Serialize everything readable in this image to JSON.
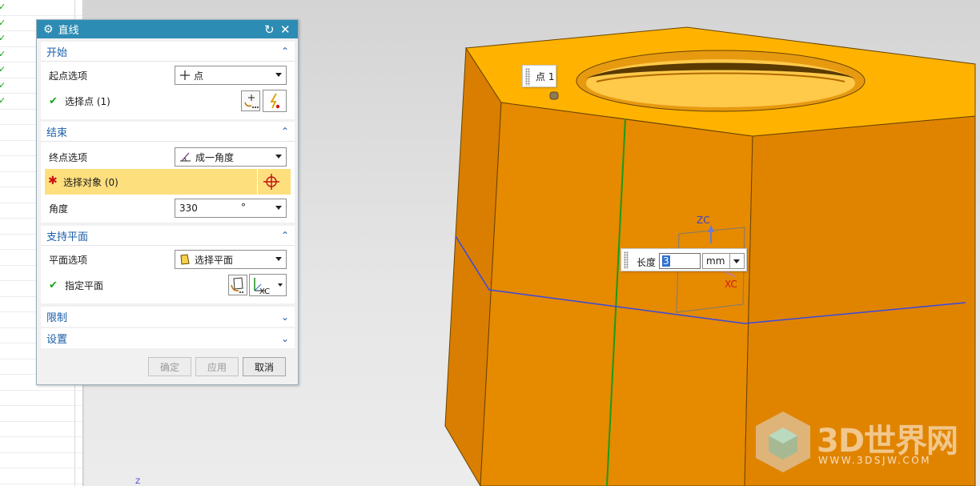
{
  "dialog": {
    "title": "直线",
    "sections": {
      "start": {
        "title": "开始",
        "option_label": "起点选项",
        "option_value": "点",
        "select_label": "选择点 (1)"
      },
      "end": {
        "title": "结束",
        "option_label": "终点选项",
        "option_value": "成一角度",
        "select_label": "选择对象 (0)",
        "angle_label": "角度",
        "angle_value": "330",
        "angle_unit": "°"
      },
      "support_plane": {
        "title": "支持平面",
        "option_label": "平面选项",
        "option_value": "选择平面",
        "specify_label": "指定平面"
      },
      "limits": {
        "title": "限制"
      },
      "settings": {
        "title": "设置"
      }
    },
    "buttons": {
      "ok": "确定",
      "apply": "应用",
      "cancel": "取消"
    }
  },
  "viewport": {
    "point_tag": "点 1",
    "length_label": "长度",
    "length_value": "3",
    "length_unit": "mm",
    "axis_zc": "ZC",
    "axis_xc": "XC",
    "triad_z": "Z"
  },
  "watermark": {
    "title": "3D世界网",
    "url": "WWW.3DSJW.COM"
  },
  "colors": {
    "title_bar": "#2d8cb4",
    "section_header": "#1b5ea8",
    "selection_highlight": "#fddf7e",
    "nut_face_top": "#ffb300",
    "nut_face_left": "#d97e00",
    "nut_face_front": "#e68a00",
    "check_green": "#1ea31e",
    "required_red": "#d01010"
  },
  "icons": {
    "title": "gear-icon",
    "reset": "reset-icon",
    "close": "close-icon",
    "point": "crosshair-point-icon",
    "angle": "angle-icon",
    "plane": "plane-icon",
    "check": "check-icon",
    "required": "asterisk-icon",
    "point_constructor": "point-constructor-icon",
    "inferred_point": "inferred-point-icon",
    "target": "target-icon",
    "plane_dialog": "plane-dialog-icon",
    "inferred_plane": "inferred-plane-icon"
  }
}
